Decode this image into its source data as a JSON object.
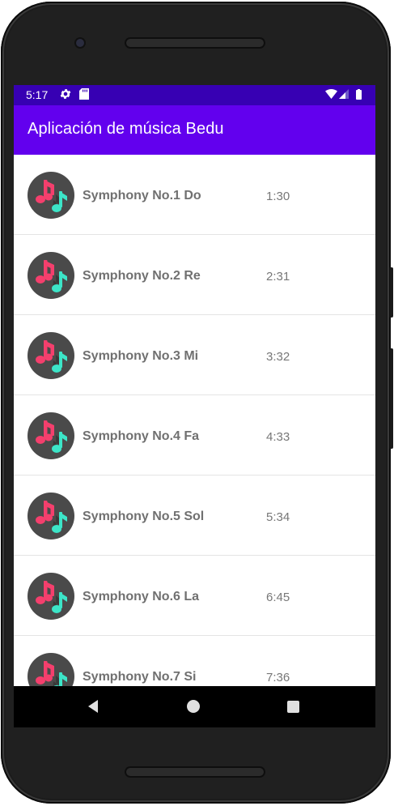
{
  "status_bar": {
    "time": "5:17"
  },
  "app_bar": {
    "title": "Aplicación de música Bedu"
  },
  "songs": [
    {
      "title": "Symphony No.1 Do",
      "duration": "1:30"
    },
    {
      "title": "Symphony No.2 Re",
      "duration": "2:31"
    },
    {
      "title": "Symphony No.3 Mi",
      "duration": "3:32"
    },
    {
      "title": "Symphony No.4 Fa",
      "duration": "4:33"
    },
    {
      "title": "Symphony No.5 Sol",
      "duration": "5:34"
    },
    {
      "title": "Symphony No.6 La",
      "duration": "6:45"
    },
    {
      "title": "Symphony No.7 Si",
      "duration": "7:36"
    }
  ],
  "icons": {
    "song": "music-note-icon",
    "status": [
      "settings-gear-icon",
      "sd-card-icon",
      "wifi-icon",
      "signal-icon",
      "battery-icon"
    ],
    "nav": [
      "back-icon",
      "home-icon",
      "recents-icon"
    ]
  },
  "colors": {
    "status_bar": "#3700b3",
    "app_bar": "#6200ee",
    "note_pink": "#f43f6d",
    "note_teal": "#3ce5c8",
    "icon_bg": "#4a4a4a"
  }
}
